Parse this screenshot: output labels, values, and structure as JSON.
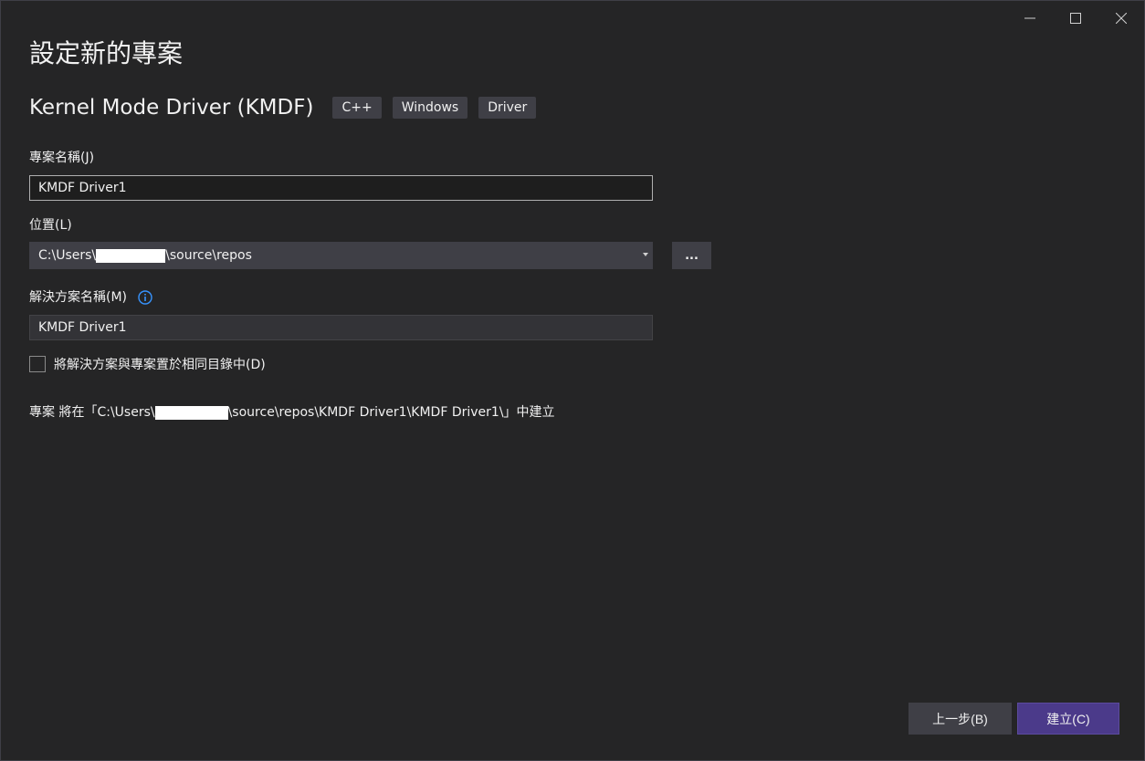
{
  "window": {
    "controls": [
      {
        "name": "minimize-icon"
      },
      {
        "name": "maximize-icon"
      },
      {
        "name": "close-icon"
      }
    ]
  },
  "header": {
    "title": "設定新的專案"
  },
  "template": {
    "name": "Kernel Mode Driver (KMDF)",
    "tags": [
      "C++",
      "Windows",
      "Driver"
    ]
  },
  "form": {
    "project_name_label": "專案名稱(J)",
    "project_name_value": "KMDF Driver1",
    "location_label": "位置(L)",
    "location_prefix": "C:\\Users\\",
    "location_suffix": "\\source\\repos",
    "browse_label": "...",
    "solution_name_label": "解決方案名稱(M)",
    "solution_name_value": "KMDF Driver1",
    "same_dir_checkbox_label": "將解決方案與專案置於相同目錄中(D)",
    "same_dir_checked": false
  },
  "path_info": {
    "prefix": "專案 將在「C:\\Users\\",
    "suffix": "\\source\\repos\\KMDF Driver1\\KMDF Driver1\\」中建立"
  },
  "footer": {
    "back_label": "上一步(B)",
    "create_label": "建立(C)"
  },
  "colors": {
    "background": "#252526",
    "accent": "#4b3a8a",
    "info_icon": "#3794ff"
  }
}
